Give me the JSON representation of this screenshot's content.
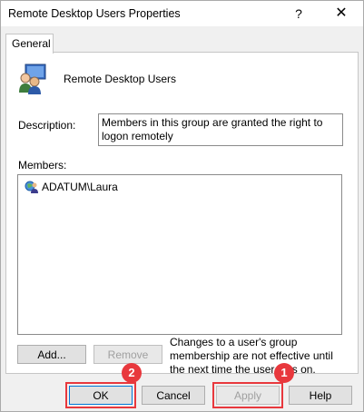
{
  "window": {
    "title": "Remote Desktop Users Properties",
    "help_glyph": "?",
    "close_glyph": "✕"
  },
  "tabs": [
    {
      "label": "General",
      "selected": true
    }
  ],
  "group": {
    "icon": "user-group-icon",
    "name": "Remote Desktop Users",
    "description_label": "Description:",
    "description": "Members in this group are granted the right to logon remotely"
  },
  "members": {
    "label": "Members:",
    "items": [
      {
        "name": "ADATUM\\Laura",
        "icon": "domain-user-icon"
      }
    ]
  },
  "buttons": {
    "add": "Add...",
    "remove": "Remove",
    "ok": "OK",
    "cancel": "Cancel",
    "apply": "Apply",
    "help": "Help"
  },
  "note": "Changes to a user's group membership are not effective until the next time the user logs on.",
  "annotations": [
    {
      "number": "1",
      "target": "Apply"
    },
    {
      "number": "2",
      "target": "OK"
    }
  ],
  "colors": {
    "callout": "#e8383d",
    "focus": "#0078d7"
  }
}
